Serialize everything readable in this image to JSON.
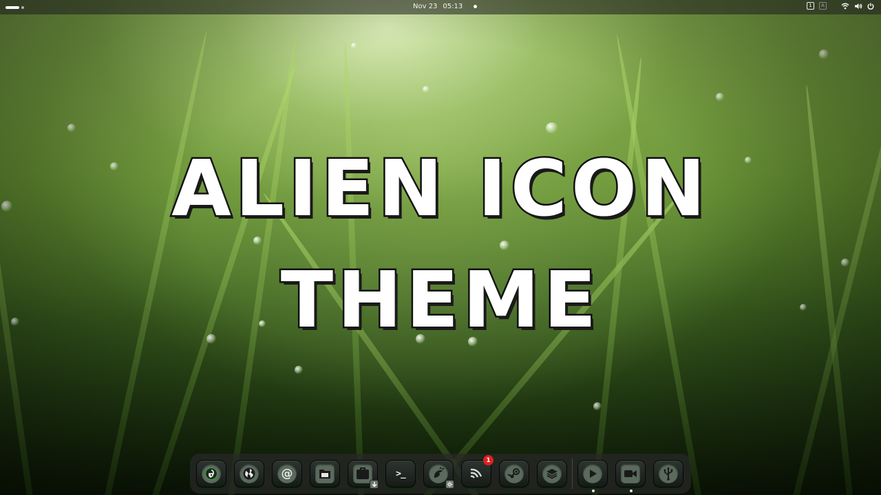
{
  "topbar": {
    "date": "Nov 23",
    "time": "05:13",
    "keyboard_indicators": [
      "1",
      "A"
    ]
  },
  "title": {
    "line1": "ALIEN ICON",
    "line2": "THEME"
  },
  "dock": {
    "items": [
      {
        "name": "fedora-icon",
        "label": ""
      },
      {
        "name": "web-browser-icon",
        "label": ""
      },
      {
        "name": "mail-icon",
        "label": "@"
      },
      {
        "name": "files-icon",
        "label": ""
      },
      {
        "name": "software-store-icon",
        "label": ""
      },
      {
        "name": "terminal-icon",
        "label": ">_"
      },
      {
        "name": "gimp-icon",
        "label": ""
      },
      {
        "name": "rss-feed-icon",
        "label": "",
        "badge": "1"
      },
      {
        "name": "steam-icon",
        "label": ""
      },
      {
        "name": "layers-icon",
        "label": ""
      },
      {
        "name": "media-player-icon",
        "label": ""
      },
      {
        "name": "video-camera-icon",
        "label": ""
      },
      {
        "name": "usb-icon",
        "label": ""
      }
    ],
    "rss_badge": "1",
    "terminal_label": ">_",
    "mail_label": "@"
  },
  "colors": {
    "accent_green": "#2aff2a",
    "badge_red": "#e02020",
    "dock_bg": "#282828"
  }
}
